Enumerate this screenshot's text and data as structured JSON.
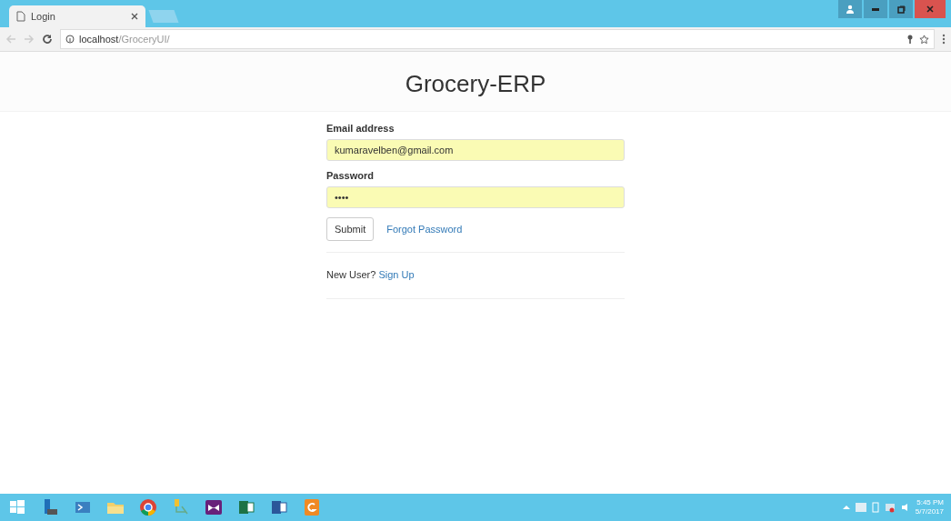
{
  "browser": {
    "tabs": [
      {
        "title": "Login",
        "selected": true
      }
    ],
    "address": {
      "host": "localhost",
      "path": "/GroceryUI/"
    }
  },
  "page": {
    "title": "Grocery-ERP",
    "fields": [
      {
        "label": "Email address",
        "value": "kumaravelben@gmail.com"
      },
      {
        "label": "Password",
        "value": "••••"
      }
    ],
    "submit": "Submit",
    "forgot": "Forgot Password",
    "new_user": "New User?",
    "signup": "Sign Up"
  },
  "taskbar": {
    "time": "5:45 PM",
    "date": "5/7/2017"
  }
}
